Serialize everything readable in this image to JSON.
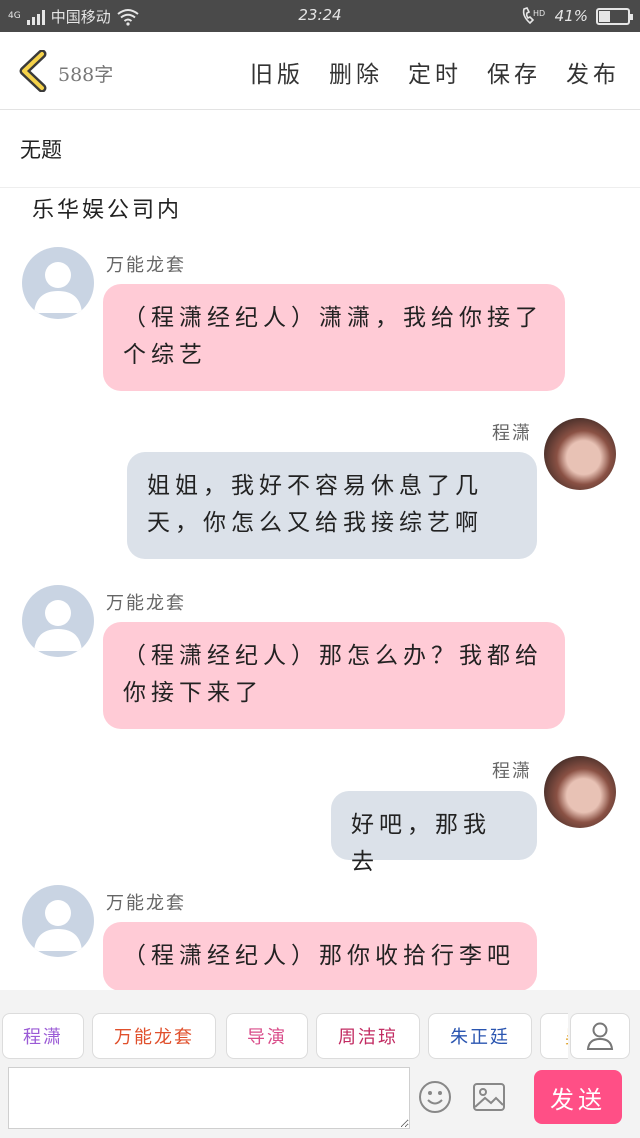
{
  "status_bar": {
    "network_type": "4G",
    "carrier": "中国移动",
    "time": "23:24",
    "hd_label": "HD",
    "battery_text": "41%",
    "battery_level": 0.41
  },
  "toolbar": {
    "word_count": "588字",
    "actions": [
      "旧版",
      "删除",
      "定时",
      "保存",
      "发布"
    ]
  },
  "document": {
    "title": "无题",
    "scene": "乐华娱公司内"
  },
  "messages": [
    {
      "name": "万能龙套",
      "text": "（程潇经纪人）潇潇，我给你接了个综艺"
    },
    {
      "name": "程潇",
      "text": "姐姐，我好不容易休息了几天，你怎么又给我接综艺啊"
    },
    {
      "name": "万能龙套",
      "text": "（程潇经纪人）那怎么办？我都给你接下来了"
    },
    {
      "name": "程潇",
      "text": "好吧，那我去"
    },
    {
      "name": "万能龙套",
      "text": "（程潇经纪人）那你收拾行李吧"
    }
  ],
  "roles": [
    {
      "label": "程潇",
      "color": "#9b5bd6"
    },
    {
      "label": "万能龙套",
      "color": "#e0502c"
    },
    {
      "label": "导演",
      "color": "#d94d8a"
    },
    {
      "label": "周洁琼",
      "color": "#c22b62"
    },
    {
      "label": "朱正廷",
      "color": "#2a55b0"
    },
    {
      "label": "吴",
      "color": "#e0a020"
    }
  ],
  "composer": {
    "input_value": "",
    "send_label": "发送"
  },
  "colors": {
    "accent": "#ff4f86",
    "bubble_pink": "#ffcbd6",
    "bubble_blue": "#dbe1e9"
  }
}
